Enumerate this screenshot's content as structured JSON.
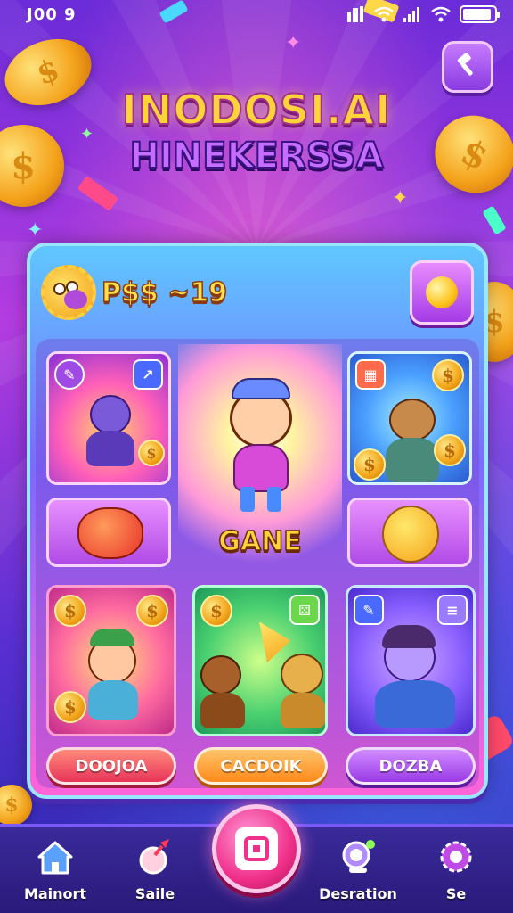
{
  "status_bar": {
    "time": "J00 9",
    "battery_level": 0.9
  },
  "title": {
    "line1": "INODOSI.AI",
    "line2": "HINEKERSSA"
  },
  "header": {
    "currency_label": "P$$ ~19"
  },
  "featured": {
    "label": "GANE"
  },
  "buttons": {
    "left": "DOOJOA",
    "middle": "CACDOIK",
    "right": "DOZBA"
  },
  "nav": {
    "items": [
      {
        "label": "Mainort",
        "icon": "home-icon"
      },
      {
        "label": "Saile",
        "icon": "rocket-icon"
      },
      {
        "label": "Desration",
        "icon": "magnifier-icon"
      },
      {
        "label": "Se",
        "icon": "gear-icon"
      }
    ],
    "center_icon": "scan-icon"
  },
  "colors": {
    "accent_pink": "#f0308a",
    "accent_gold": "#ffd33a",
    "accent_purple": "#9a3ae6"
  }
}
